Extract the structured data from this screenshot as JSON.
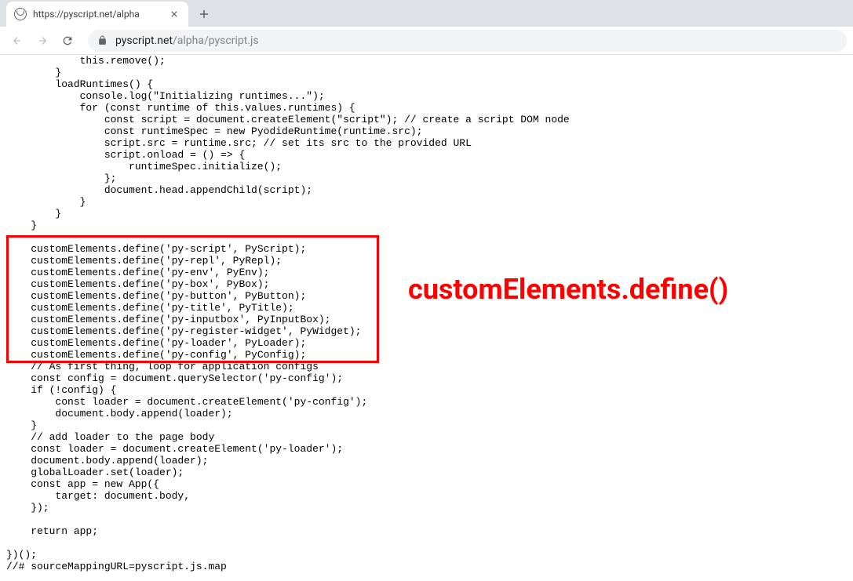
{
  "tab": {
    "title": "https://pyscript.net/alpha"
  },
  "url": {
    "host": "pyscript.net",
    "path": "/alpha/pyscript.js"
  },
  "code": "            this.remove();\n        }\n        loadRuntimes() {\n            console.log(\"Initializing runtimes...\");\n            for (const runtime of this.values.runtimes) {\n                const script = document.createElement(\"script\"); // create a script DOM node\n                const runtimeSpec = new PyodideRuntime(runtime.src);\n                script.src = runtime.src; // set its src to the provided URL\n                script.onload = () => {\n                    runtimeSpec.initialize();\n                };\n                document.head.appendChild(script);\n            }\n        }\n    }\n\n    customElements.define('py-script', PyScript);\n    customElements.define('py-repl', PyRepl);\n    customElements.define('py-env', PyEnv);\n    customElements.define('py-box', PyBox);\n    customElements.define('py-button', PyButton);\n    customElements.define('py-title', PyTitle);\n    customElements.define('py-inputbox', PyInputBox);\n    customElements.define('py-register-widget', PyWidget);\n    customElements.define('py-loader', PyLoader);\n    customElements.define('py-config', PyConfig);\n    // As first thing, loop for application configs\n    const config = document.querySelector('py-config');\n    if (!config) {\n        const loader = document.createElement('py-config');\n        document.body.append(loader);\n    }\n    // add loader to the page body\n    const loader = document.createElement('py-loader');\n    document.body.append(loader);\n    globalLoader.set(loader);\n    const app = new App({\n        target: document.body,\n    });\n\n    return app;\n\n})();\n//# sourceMappingURL=pyscript.js.map",
  "annotation": "customElements.define()"
}
